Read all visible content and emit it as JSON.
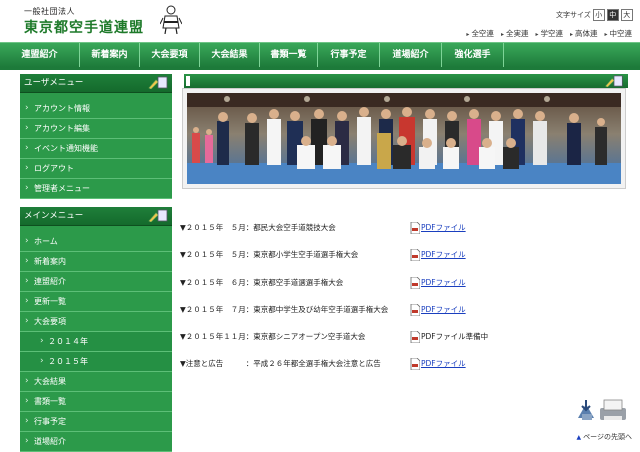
{
  "header": {
    "org_type": "一般社団法人",
    "org_name": "東京都空手道連盟",
    "fontsize_label": "文字サイズ",
    "fontsize_options": [
      "小",
      "中",
      "大"
    ],
    "toplinks": [
      "全空連",
      "全実連",
      "学空連",
      "高体連",
      "中空連"
    ]
  },
  "nav": {
    "items": [
      "連盟紹介",
      "新着案内",
      "大会要項",
      "大会結果",
      "書類一覧",
      "行事予定",
      "道場紹介",
      "強化選手"
    ]
  },
  "sidebar": {
    "user_menu_title": "ユーザメニュー",
    "user_menu": [
      "アカウント情報",
      "アカウント編集",
      "イベント通知機能",
      "ログアウト",
      "管理者メニュー"
    ],
    "main_menu_title": "メインメニュー",
    "main_menu": [
      {
        "label": "ホーム",
        "sub": false
      },
      {
        "label": "新着案内",
        "sub": false
      },
      {
        "label": "連盟紹介",
        "sub": false
      },
      {
        "label": "更新一覧",
        "sub": false
      },
      {
        "label": "大会要項",
        "sub": false
      },
      {
        "label": "２０１４年",
        "sub": true
      },
      {
        "label": "２０１５年",
        "sub": true
      },
      {
        "label": "大会結果",
        "sub": false
      },
      {
        "label": "書類一覧",
        "sub": false
      },
      {
        "label": "行事予定",
        "sub": false
      },
      {
        "label": "道場紹介",
        "sub": false
      }
    ]
  },
  "main": {
    "events": [
      {
        "title": "▼２０１５年　５月：都民大会空手道競技大会",
        "file": "PDFファイル",
        "linked": true
      },
      {
        "title": "▼２０１５年　５月：東京都小学生空手道選手権大会",
        "file": "PDFファイル",
        "linked": true
      },
      {
        "title": "▼２０１５年　６月：東京都空手道選選手権大会",
        "file": "PDFファイル",
        "linked": true
      },
      {
        "title": "▼２０１５年　７月：東京都中学生及び幼年空手道選手権大会",
        "file": "PDFファイル",
        "linked": true
      },
      {
        "title": "▼２０１５年１１月：東京都シニアオープン空手道大会",
        "file": "PDFファイル準備中",
        "linked": false
      },
      {
        "title": "▼注意と広告　　　：平成２６年都全選手権大会注意と広告",
        "file": "PDFファイル",
        "linked": true
      }
    ],
    "page_top": "ページの先頭へ"
  },
  "colors": {
    "nav_green": "#2a9447",
    "sidebar_green": "#2c9a4a",
    "link_blue": "#1a3fbf"
  }
}
